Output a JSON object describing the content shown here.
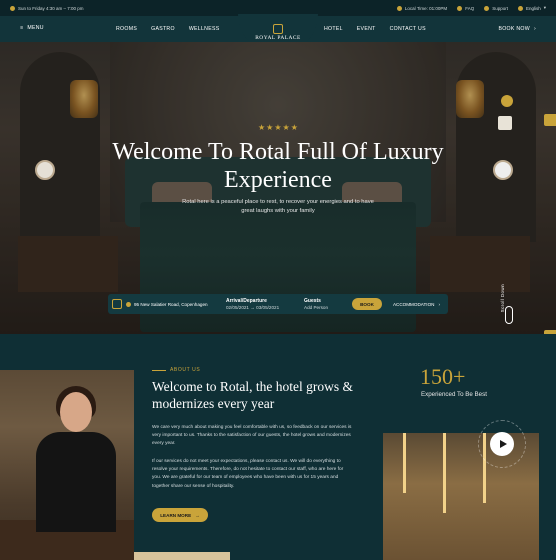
{
  "topbar": {
    "hours": "Sun to Friday 4:30 am – 7:00 pm",
    "local_time": "Local Time: 01:00PM",
    "faq": "FAQ",
    "support": "Support",
    "language": "English"
  },
  "nav": {
    "menu_label": "MENU",
    "left_links": [
      "ROOMS",
      "GASTRO",
      "WELLNESS"
    ],
    "logo_text": "ROYAL PALACE",
    "right_links": [
      "HOTEL",
      "EVENT",
      "CONTACT US"
    ],
    "book_label": "BOOK NOW"
  },
  "hero": {
    "stars": "★★★★★",
    "title": "Welcome To Rotal Full Of Luxury Experience",
    "lead": "Rotal here is a peaceful place to rest, to recover your energies and to have great laughs with your family",
    "scroll_label": "Scroll Down"
  },
  "booking": {
    "location": "95 New Salatier Road, Copenhagen",
    "arrival_label": "Arrival/Departure",
    "arrival_value": "02/05/2021 → 03/05/2021",
    "guests_label": "Guests",
    "guests_value": "Add Person",
    "book_button": "BOOK",
    "accommodation": "ACCOMMODATION"
  },
  "about": {
    "tag": "ABOUT US",
    "title": "Welcome to Rotal, the hotel grows & modernizes every year",
    "para1": "We care very much about making you feel comfortable with us, so feedback on our services is very important to us. Thanks to the satisfaction of our guests, the hotel grows and modernizes every year.",
    "para2": "If our services do not meet your expectations, please contact us. We will do everything to resolve your requirements. Therefore, do not hesitate to contact our staff, who are here for you. We are grateful for our team of employees who have been with us for 15 years and together share our sense of hospitality.",
    "more_button": "LEARN MORE",
    "counter": "150+",
    "counter_label": "Experienced To Be Best"
  }
}
